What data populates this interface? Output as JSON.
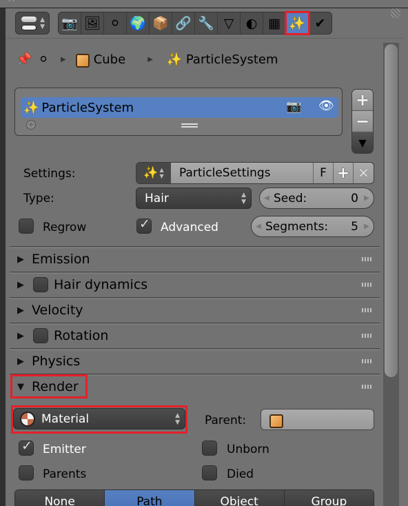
{
  "header": {
    "context_tabs": [
      {
        "name": "render",
        "icon": "camera-icon",
        "glyph": "📷"
      },
      {
        "name": "render-layers",
        "icon": "render-layers-icon",
        "glyph": "🖼"
      },
      {
        "name": "scene",
        "icon": "scene-icon",
        "glyph": "⚪"
      },
      {
        "name": "world",
        "icon": "world-icon",
        "glyph": "🌍"
      },
      {
        "name": "object",
        "icon": "object-cube-icon",
        "glyph": "📦"
      },
      {
        "name": "constraints",
        "icon": "chain-link-icon",
        "glyph": "🔗"
      },
      {
        "name": "modifiers",
        "icon": "wrench-icon",
        "glyph": "🔧"
      },
      {
        "name": "data",
        "icon": "mesh-triangle-icon",
        "glyph": "▽"
      },
      {
        "name": "material",
        "icon": "material-sphere-icon",
        "glyph": "◐"
      },
      {
        "name": "texture",
        "icon": "checker-texture-icon",
        "glyph": "▦"
      },
      {
        "name": "particles",
        "icon": "particles-sparkle-icon",
        "glyph": "✨",
        "active": true
      },
      {
        "name": "physics",
        "icon": "physics-icon",
        "glyph": "✔"
      }
    ]
  },
  "breadcrumb": {
    "items": [
      "Cube",
      "ParticleSystem"
    ]
  },
  "particle_list": {
    "items": [
      {
        "name": "ParticleSystem",
        "selected": true
      }
    ]
  },
  "settings": {
    "settings_label": "Settings:",
    "settings_value": "ParticleSettings",
    "fake_user": "F",
    "type_label": "Type:",
    "type_value": "Hair",
    "seed_label": "Seed:",
    "seed_value": "0",
    "regrow_label": "Regrow",
    "regrow_checked": false,
    "advanced_label": "Advanced",
    "advanced_checked": true,
    "segments_label": "Segments:",
    "segments_value": "5"
  },
  "panels": [
    {
      "title": "Emission",
      "expanded": false,
      "has_checkbox": false
    },
    {
      "title": "Hair dynamics",
      "expanded": false,
      "has_checkbox": true
    },
    {
      "title": "Velocity",
      "expanded": false,
      "has_checkbox": false
    },
    {
      "title": "Rotation",
      "expanded": false,
      "has_checkbox": true
    },
    {
      "title": "Physics",
      "expanded": false,
      "has_checkbox": false
    },
    {
      "title": "Render",
      "expanded": true,
      "has_checkbox": false
    }
  ],
  "render": {
    "material_value": "Material",
    "parent_label": "Parent:",
    "emitter_label": "Emitter",
    "emitter_checked": true,
    "unborn_label": "Unborn",
    "unborn_checked": false,
    "parents_label": "Parents",
    "parents_checked": false,
    "died_label": "Died",
    "died_checked": false,
    "render_as": [
      "None",
      "Path",
      "Object",
      "Group"
    ],
    "render_as_selected": "Path"
  },
  "colors": {
    "accent": "#5680c2",
    "highlight": "#e5202a",
    "background": "#727272"
  }
}
